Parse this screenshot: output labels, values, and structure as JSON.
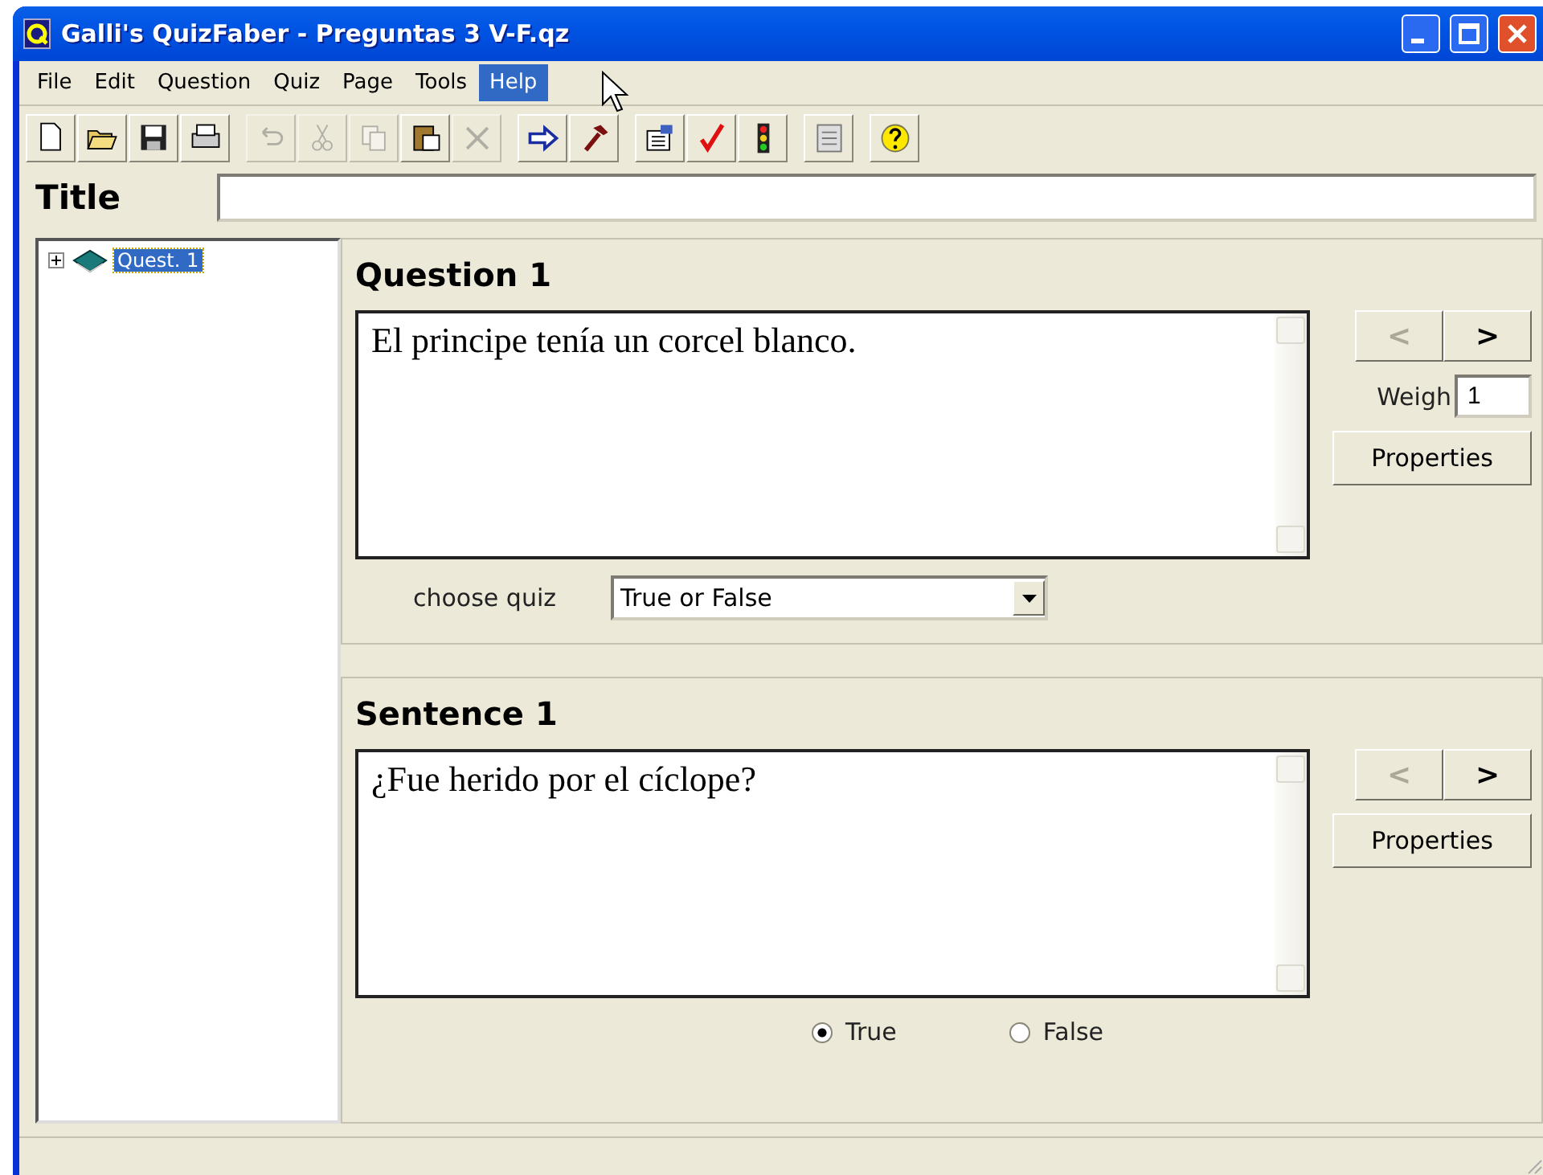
{
  "window": {
    "title": "Galli's QuizFaber - Preguntas 3 V-F.qz"
  },
  "menu": [
    {
      "label": "File",
      "selected": false
    },
    {
      "label": "Edit",
      "selected": false
    },
    {
      "label": "Question",
      "selected": false
    },
    {
      "label": "Quiz",
      "selected": false
    },
    {
      "label": "Page",
      "selected": false
    },
    {
      "label": "Tools",
      "selected": false
    },
    {
      "label": "Help",
      "selected": true
    }
  ],
  "toolbar": [
    [
      {
        "kind": "new",
        "disabled": false
      },
      {
        "kind": "open",
        "disabled": false
      },
      {
        "kind": "save",
        "disabled": false
      },
      {
        "kind": "print",
        "disabled": false
      }
    ],
    [
      {
        "kind": "undo",
        "disabled": true
      },
      {
        "kind": "cut",
        "disabled": true
      },
      {
        "kind": "copy",
        "disabled": true
      },
      {
        "kind": "paste",
        "disabled": false
      },
      {
        "kind": "delete",
        "disabled": true
      }
    ],
    [
      {
        "kind": "arrow",
        "disabled": false
      },
      {
        "kind": "hammer",
        "disabled": false
      }
    ],
    [
      {
        "kind": "properties",
        "disabled": false
      },
      {
        "kind": "check",
        "disabled": false
      },
      {
        "kind": "traffic",
        "disabled": false
      }
    ],
    [
      {
        "kind": "document",
        "disabled": false
      }
    ],
    [
      {
        "kind": "help",
        "disabled": false
      }
    ]
  ],
  "title_field": {
    "label": "Title"
  },
  "tree": [
    {
      "label": "Quest. 1",
      "selected": true,
      "expanded": false
    }
  ],
  "question": {
    "heading": "Question 1",
    "text": "El principe tenía un corcel blanco.",
    "prev": "<",
    "next": ">",
    "prev_disabled": true,
    "weight_label": "Weigh",
    "weight": "1",
    "properties": "Properties",
    "choose_label": "choose quiz",
    "quiz_type": "True or False"
  },
  "sentence": {
    "heading": "Sentence 1",
    "text": "¿Fue herido por el cíclope?",
    "prev": "<",
    "next": ">",
    "prev_disabled": true,
    "properties": "Properties",
    "answers": [
      {
        "label": "True",
        "selected": true
      },
      {
        "label": "False",
        "selected": false
      }
    ]
  }
}
